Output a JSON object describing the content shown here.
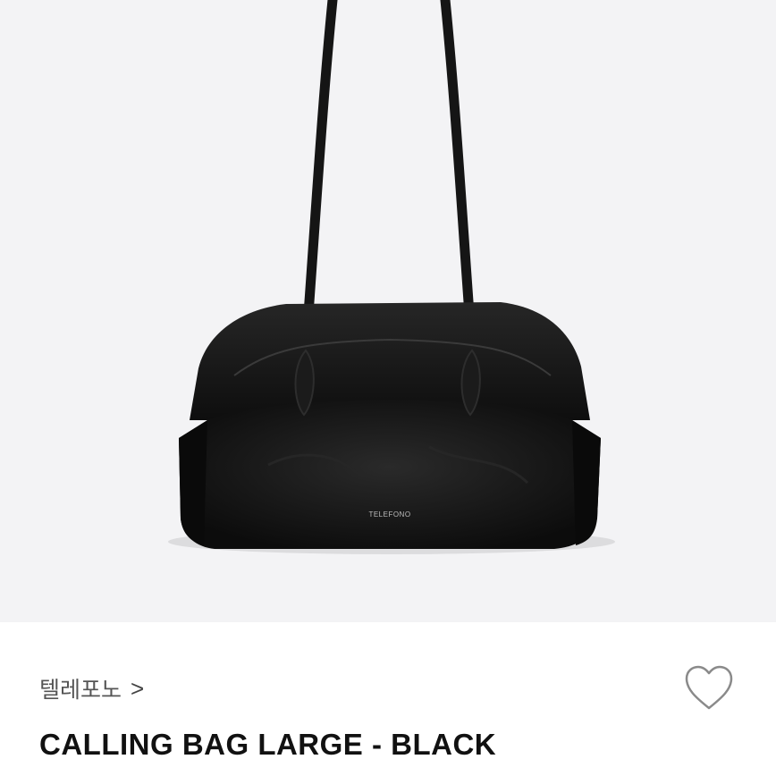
{
  "product": {
    "image_alt": "black shoulder bag",
    "bag_logo_text": "TELEFONO",
    "brand": "텔레포노",
    "brand_chevron": ">",
    "title": "CALLING BAG LARGE - BLACK"
  },
  "icons": {
    "wishlist": "heart-outline-icon",
    "brand_arrow": "chevron-right-icon"
  },
  "colors": {
    "image_background": "#f3f3f5",
    "bag": "#141414",
    "text_primary": "#111111",
    "text_secondary": "#555555"
  }
}
